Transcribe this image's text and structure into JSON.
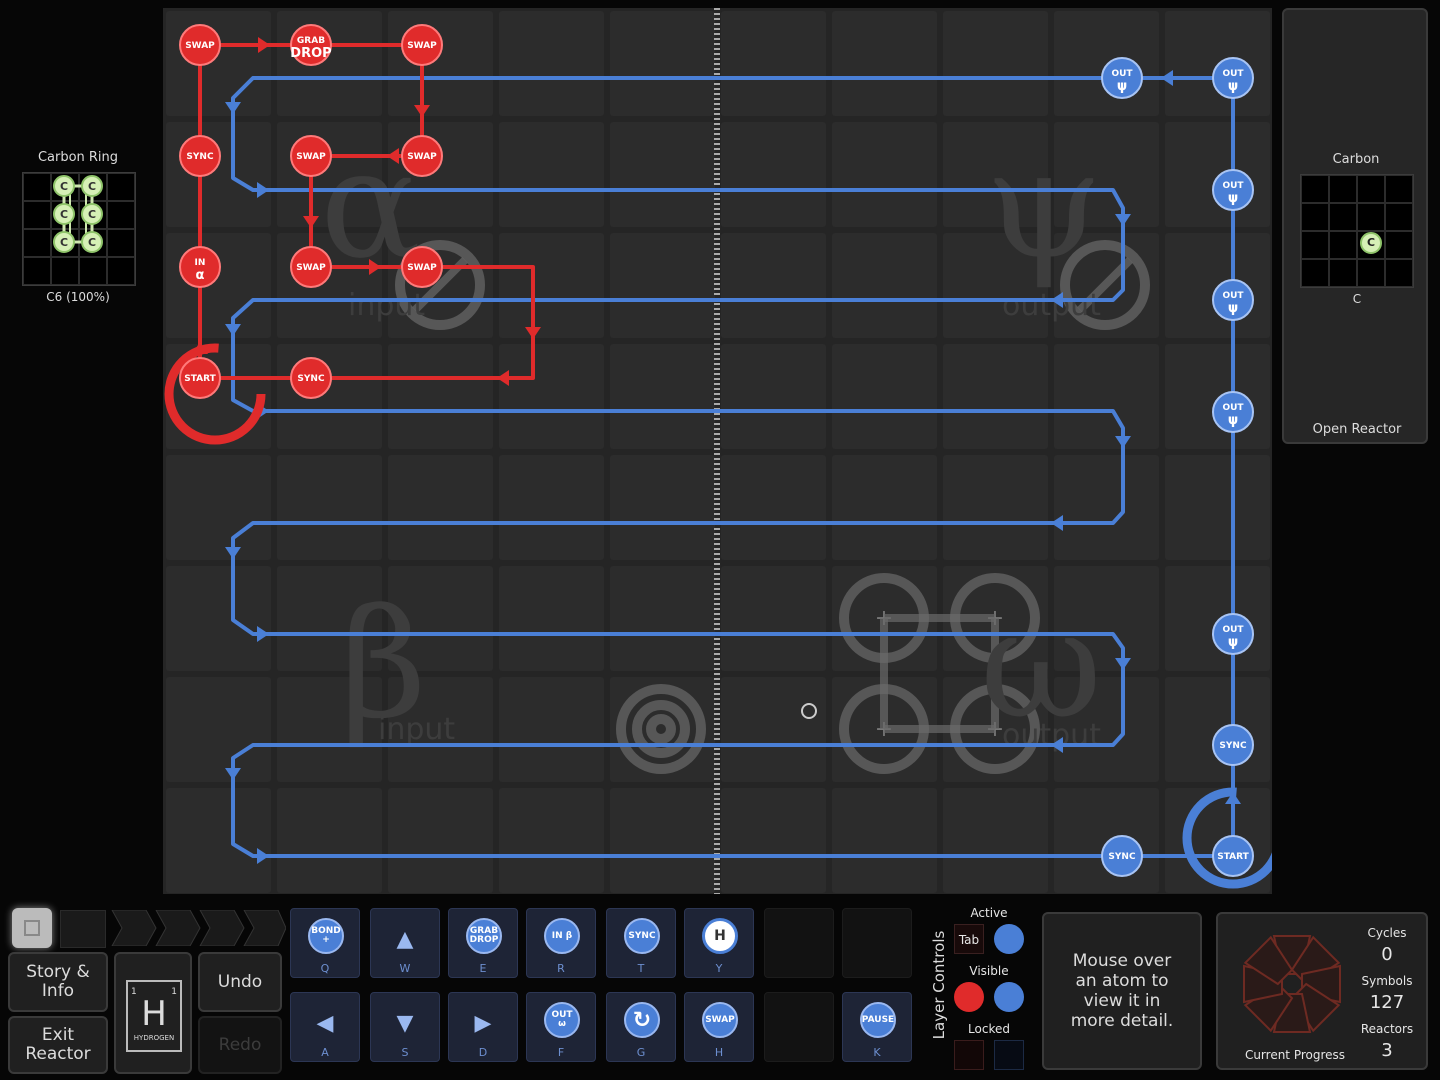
{
  "left_panel": {
    "title": "Carbon Ring",
    "formula": "C6 (100%)",
    "atoms": [
      "C",
      "C",
      "C",
      "C",
      "C",
      "C"
    ]
  },
  "right_panel": {
    "title": "Carbon",
    "formula": "C",
    "atoms": [
      "C"
    ],
    "reactor_label": "Open Reactor"
  },
  "board": {
    "zone_labels": {
      "alpha": "α",
      "alpha_word": "input",
      "psi": "ψ",
      "psi_word": "output",
      "beta": "β",
      "beta_word": "input",
      "omega": "ω",
      "omega_word": "output"
    },
    "red_waldo": {
      "start": "START",
      "sync": "SYNC",
      "swap": "SWAP",
      "grab_drop": "GRAB DROP",
      "in_line1": "IN",
      "in_line2": "α"
    },
    "blue_waldo": {
      "start": "START",
      "sync": "SYNC",
      "out_line1": "OUT",
      "out_line2": "ψ"
    },
    "colors": {
      "red": "#e02b2b",
      "blue": "#4a7fd6",
      "board": "#272727"
    }
  },
  "controls": {
    "run_states": [
      "stop",
      "pause",
      "step",
      "play",
      "fast",
      "faster"
    ],
    "story_info": "Story & Info",
    "exit_reactor": "Exit Reactor",
    "undo": "Undo",
    "redo": "Redo",
    "element": {
      "symbol": "H",
      "name": "HYDROGEN",
      "left_num": "1",
      "right_num": "1"
    }
  },
  "tools": [
    {
      "label": "BOND +",
      "key": "Q",
      "icon": "bond-plus"
    },
    {
      "label": "",
      "key": "W",
      "icon": "arrow-up"
    },
    {
      "label": "GRAB DROP",
      "key": "E",
      "icon": "grab-drop"
    },
    {
      "label": "IN β",
      "key": "R",
      "icon": "in-beta"
    },
    {
      "label": "SYNC",
      "key": "T",
      "icon": "sync"
    },
    {
      "label": "H",
      "key": "Y",
      "icon": "sense-h"
    },
    {
      "label": "",
      "key": "A",
      "icon": "arrow-left"
    },
    {
      "label": "",
      "key": "S",
      "icon": "arrow-down"
    },
    {
      "label": "",
      "key": "D",
      "icon": "arrow-right"
    },
    {
      "label": "OUT ω",
      "key": "F",
      "icon": "out-omega"
    },
    {
      "label": "",
      "key": "G",
      "icon": "rotate"
    },
    {
      "label": "SWAP",
      "key": "H",
      "icon": "swap"
    },
    {
      "label": "PAUSE",
      "key": "K",
      "icon": "pause"
    }
  ],
  "layer_controls": {
    "title": "Layer Controls",
    "active": "Active",
    "tab": "Tab",
    "visible": "Visible",
    "locked": "Locked"
  },
  "info_box": "Mouse over an atom to view it in more detail.",
  "progress": {
    "cycles_label": "Cycles",
    "cycles": "0",
    "symbols_label": "Symbols",
    "symbols": "127",
    "reactors_label": "Reactors",
    "reactors": "3",
    "current": "Current Progress"
  }
}
